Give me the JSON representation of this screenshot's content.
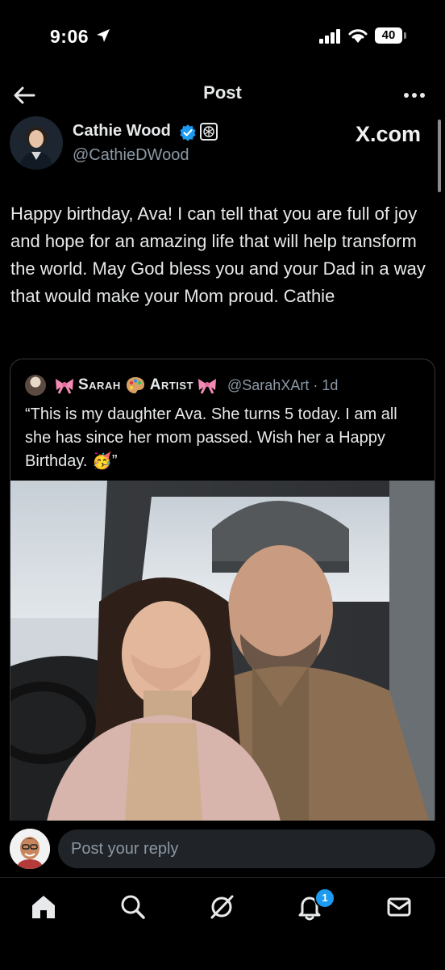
{
  "status": {
    "time": "9:06",
    "battery": "40"
  },
  "header": {
    "title": "Post"
  },
  "post": {
    "author_name": "Cathie Wood",
    "handle": "@CathieDWood",
    "watermark": "X.com",
    "text": "Happy birthday, Ava! I can tell that you are full of joy and hope for an amazing life that will help transform the world. May God bless you and your Dad in a way that would make your Mom proud. Cathie"
  },
  "quote": {
    "name_first": "Sarah",
    "name_second": "Artist",
    "handle": "@SarahXArt",
    "time": "1d",
    "text": "“This is my daughter Ava. She turns 5 today. I am all she has since her mom passed. Wish her a Happy Birthday. 🥳”"
  },
  "reply": {
    "placeholder": "Post your reply"
  },
  "tabs": {
    "notifications_badge": "1"
  },
  "colors": {
    "accent": "#1d9bf0",
    "background": "#000000",
    "text": "#e7e9ea",
    "muted": "#8b98a5"
  }
}
